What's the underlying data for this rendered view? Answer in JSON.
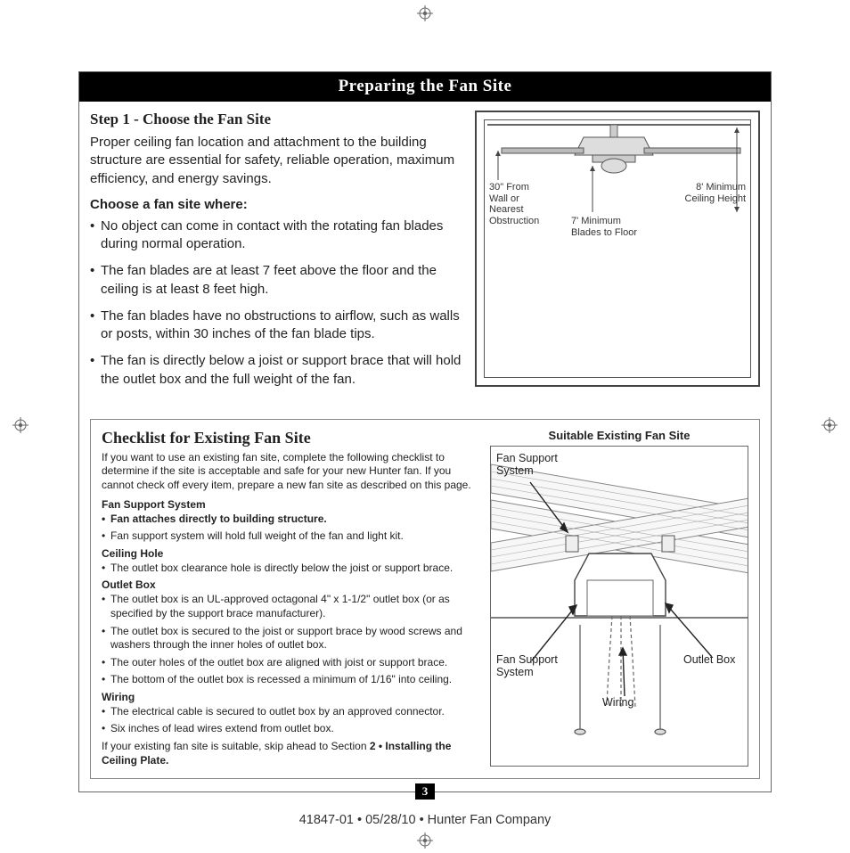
{
  "banner": "Preparing the Fan Site",
  "step1": {
    "title": "Step 1 - Choose the Fan Site",
    "intro": "Proper ceiling fan location and attachment to the building structure are essential for safety, reliable operation, maximum efficiency, and energy savings.",
    "subhead": "Choose a fan site where:",
    "bullets": [
      "No object can come in contact with the rotating fan blades during normal operation.",
      "The fan blades are at least 7 feet above the floor and the ceiling is at least 8 feet high.",
      "The fan blades have no obstructions to airflow, such as walls or posts, within 30 inches of the fan blade tips.",
      "The fan is directly below a joist or support brace that will hold the outlet box and the full weight of the fan."
    ]
  },
  "diagram1_labels": {
    "left": "30\" From Wall or Nearest Obstruction",
    "center": "7' Minimum Blades to Floor",
    "right": "8' Minimum Ceiling Height"
  },
  "checklist": {
    "title": "Checklist for Existing Fan Site",
    "intro": "If you want to use an existing fan site, complete the following checklist to determine if the site is acceptable and safe for your new Hunter fan. If you cannot check off every item, prepare a new fan site as described on this page.",
    "sections": {
      "fss_head": "Fan Support System",
      "fss_items": [
        "Fan attaches directly to building structure.",
        "Fan support system will hold full weight of the fan and light kit."
      ],
      "ch_head": "Ceiling Hole",
      "ch_items": [
        "The outlet box clearance hole is directly below the joist or support brace."
      ],
      "ob_head": "Outlet Box",
      "ob_items": [
        "The outlet box is an UL-approved octagonal 4\" x 1-1/2\" outlet box (or as specified by the support brace manufacturer).",
        "The outlet box is secured to the joist or support brace by wood screws and washers through the inner holes of outlet box.",
        "The outer holes of the outlet box are aligned with joist or support brace.",
        "The bottom of the outlet box is recessed a minimum of 1/16\" into ceiling."
      ],
      "w_head": "Wiring",
      "w_items": [
        "The electrical cable is secured to outlet box by an approved connector.",
        "Six inches of lead wires extend from outlet box."
      ]
    },
    "footer_pre": "If your existing fan site is suitable, skip ahead to Section ",
    "footer_bold": "2 • Installing the Ceiling Plate."
  },
  "diagram2": {
    "title": "Suitable Existing Fan Site",
    "labels": {
      "fss_top": "Fan Support System",
      "fss_bottom": "Fan Support System",
      "wiring": "Wiring",
      "outlet": "Outlet Box"
    }
  },
  "page_number": "3",
  "footer": "41847-01  •  05/28/10  •  Hunter Fan Company"
}
